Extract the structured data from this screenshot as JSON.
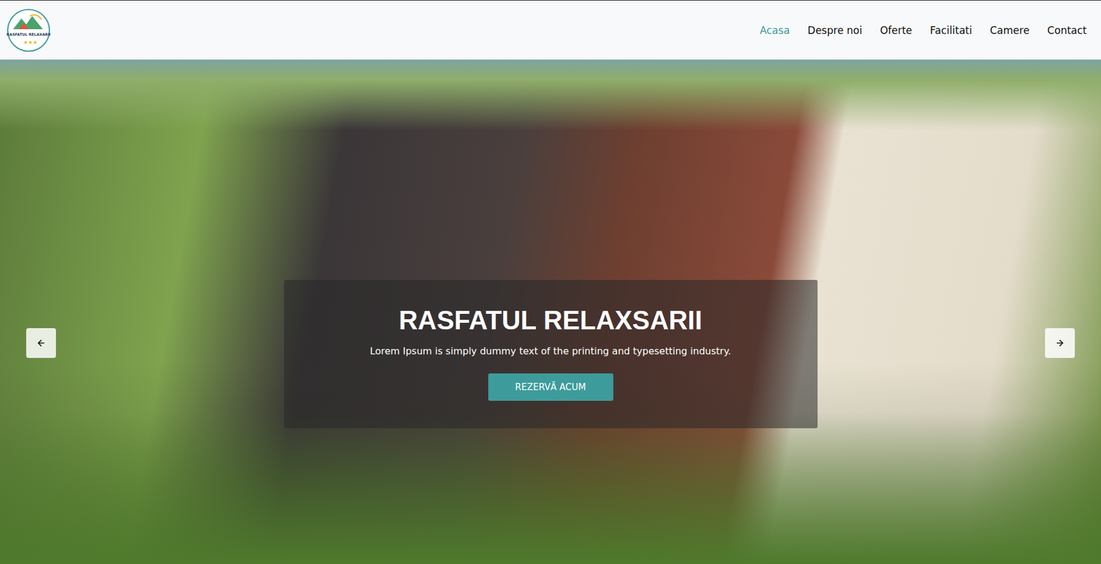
{
  "header": {
    "logo": {
      "text": "RASFATUL RELAXARII",
      "stars": 3
    },
    "nav": [
      {
        "label": "Acasa",
        "selected": true
      },
      {
        "label": "Despre noi",
        "selected": false
      },
      {
        "label": "Oferte",
        "selected": false
      },
      {
        "label": "Facilitati",
        "selected": false
      },
      {
        "label": "Camere",
        "selected": false
      },
      {
        "label": "Contact",
        "selected": false
      }
    ]
  },
  "hero": {
    "title": "RASFATUL RELAXSARII",
    "subtitle": "Lorem Ipsum is simply dummy text of the printing and typesetting industry.",
    "button": "REZERVĂ ACUM"
  }
}
